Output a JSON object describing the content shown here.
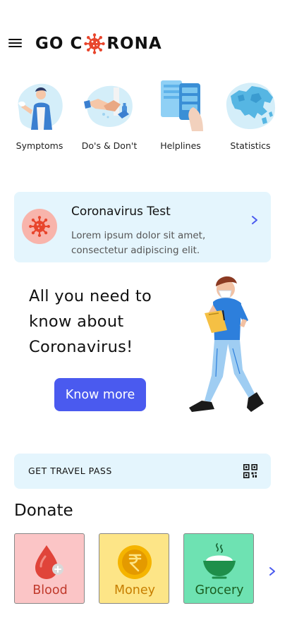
{
  "header": {
    "logo_left": "GO C",
    "logo_right": "RONA"
  },
  "categories": [
    {
      "label": "Symptoms",
      "icon": "coughing-person-icon"
    },
    {
      "label": "Do's & Don't",
      "icon": "hand-washing-icon"
    },
    {
      "label": "Helplines",
      "icon": "phone-in-hand-icon"
    },
    {
      "label": "Statistics",
      "icon": "world-map-icon"
    }
  ],
  "test_card": {
    "title": "Coronavirus Test",
    "description": "Lorem ipsum dolor sit amet, consectetur adipiscing elit."
  },
  "hero": {
    "headline": "All you need to know about Coronavirus!",
    "button": "Know more"
  },
  "travel_pass": {
    "label": "GET TRAVEL PASS"
  },
  "donate": {
    "title": "Donate",
    "items": [
      {
        "label": "Blood",
        "icon": "blood-drop-icon"
      },
      {
        "label": "Money",
        "icon": "rupee-coin-icon"
      },
      {
        "label": "Grocery",
        "icon": "food-bowl-icon"
      }
    ]
  },
  "colors": {
    "accent": "#4a5aef",
    "card_bg": "#e4f5fd",
    "virus_red": "#e8452c"
  }
}
